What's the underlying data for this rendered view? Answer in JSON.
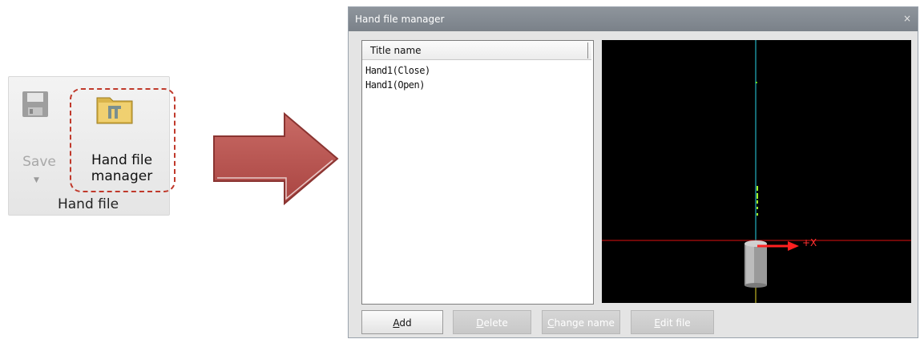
{
  "ribbon": {
    "save_label": "Save",
    "save_dropdown": "▼",
    "hand_file_manager_line1": "Hand file",
    "hand_file_manager_line2": "manager",
    "group_label": "Hand file",
    "highlight_color": "#c0392b"
  },
  "dialog": {
    "title": "Hand file manager",
    "close": "×",
    "list": {
      "column_header": "Title name",
      "items": [
        "Hand1(Close)",
        "Hand1(Open)"
      ]
    },
    "viewport": {
      "axis_label": "+X",
      "background": "#000000"
    },
    "buttons": {
      "add": {
        "first": "A",
        "rest": "dd"
      },
      "delete": {
        "first": "D",
        "rest": "elete"
      },
      "change_name": {
        "first": "C",
        "rest": "hange name"
      },
      "edit_file": {
        "first": "E",
        "rest": "dit file"
      }
    }
  },
  "icons": [
    "save-icon",
    "hand-file-manager-folder-icon",
    "arrow-right-icon",
    "close-icon",
    "hand-3d-model-icon"
  ]
}
